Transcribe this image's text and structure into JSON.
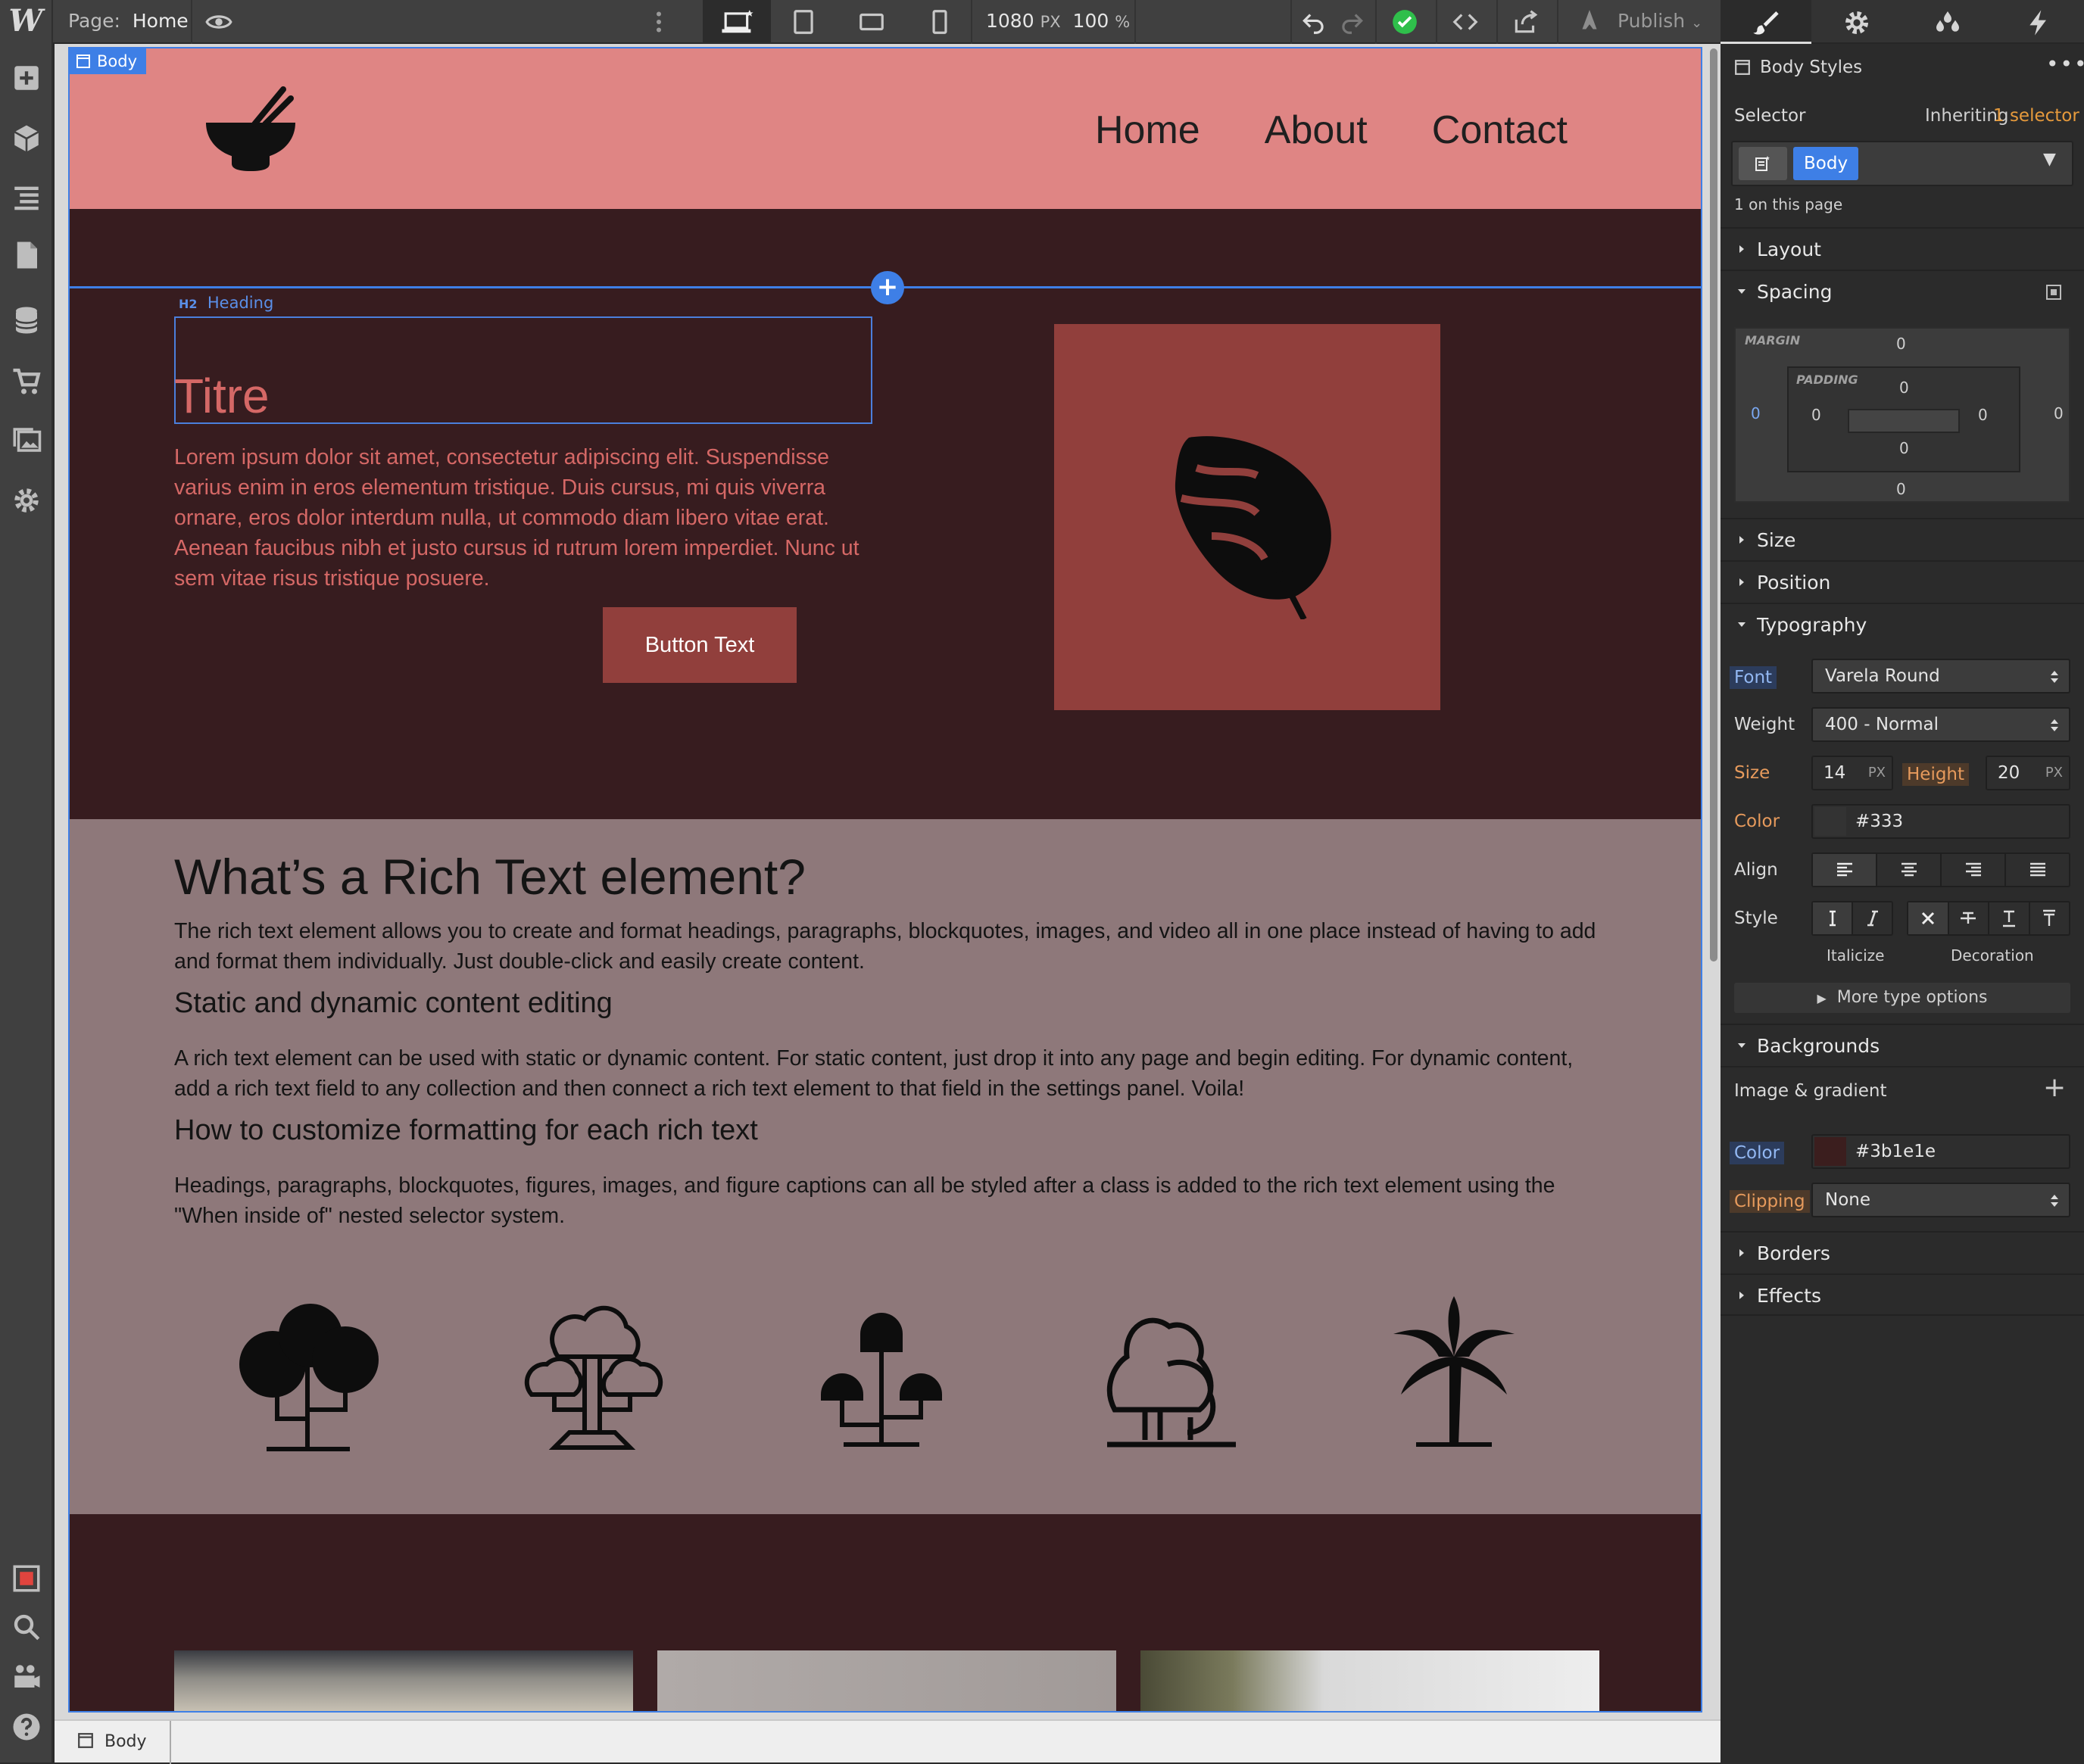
{
  "topbar": {
    "logo": "W",
    "page_label": "Page:",
    "page_name": "Home",
    "width_value": "1080",
    "width_unit": "PX",
    "zoom_value": "100",
    "zoom_unit": "%",
    "publish_label": "Publish"
  },
  "canvas": {
    "body_tag": "Body",
    "nav": {
      "links": [
        "Home",
        "About",
        "Contact"
      ]
    },
    "hero": {
      "heading_label": "Heading",
      "heading_tag": "H2",
      "title": "Titre",
      "paragraph": "Lorem ipsum dolor sit amet, consectetur adipiscing elit. Suspendisse varius enim in eros elementum tristique. Duis cursus, mi quis viverra ornare, eros dolor interdum nulla, ut commodo diam libero vitae erat. Aenean faucibus nibh et justo cursus id rutrum lorem imperdiet. Nunc ut sem vitae risus tristique posuere.",
      "button_text": "Button Text"
    },
    "rich_text": {
      "h1": "What’s a Rich Text element?",
      "p1": "The rich text element allows you to create and format headings, paragraphs, blockquotes, images, and video all in one place instead of having to add and format them individually. Just double-click and easily create content.",
      "h2": "Static and dynamic content editing",
      "p2": "A rich text element can be used with static or dynamic content. For static content, just drop it into any page and begin editing. For dynamic content, add a rich text field to any collection and then connect a rich text element to that field in the settings panel. Voila!",
      "h3": "How to customize formatting for each rich text",
      "p3": "Headings, paragraphs, blockquotes, figures, images, and figure captions can all be styled after a class is added to the rich text element using the \"When inside of\" nested selector system."
    },
    "trees": [
      "round-tree-icon",
      "cloud-tree-icon",
      "mushroom-tree-icon",
      "bush-tree-icon",
      "palm-tree-icon"
    ]
  },
  "breadcrumb": {
    "item": "Body"
  },
  "panel": {
    "title": "Body Styles",
    "selector_label": "Selector",
    "inheriting_text": "Inheriting",
    "inheriting_link": "1 selector",
    "selector_chip": "Body",
    "on_page": "1 on this page",
    "sections": {
      "layout": "Layout",
      "spacing": "Spacing",
      "size": "Size",
      "position": "Position",
      "typography": "Typography",
      "backgrounds": "Backgrounds",
      "borders": "Borders",
      "effects": "Effects"
    },
    "spacing": {
      "margin_label": "MARGIN",
      "padding_label": "PADDING",
      "margin": {
        "top": "0",
        "right": "0",
        "bottom": "0",
        "left": "0"
      },
      "padding": {
        "top": "0",
        "right": "0",
        "bottom": "0",
        "left": "0"
      }
    },
    "typography": {
      "font_label": "Font",
      "font_value": "Varela Round",
      "weight_label": "Weight",
      "weight_value": "400 - Normal",
      "size_label": "Size",
      "size_value": "14",
      "size_unit": "PX",
      "height_label": "Height",
      "height_value": "20",
      "height_unit": "PX",
      "color_label": "Color",
      "color_value": "#333",
      "align_label": "Align",
      "style_label": "Style",
      "italicize": "Italicize",
      "decoration": "Decoration",
      "more": "More type options"
    },
    "backgrounds": {
      "image_gradient": "Image & gradient",
      "color_label": "Color",
      "color_value": "#3b1e1e",
      "clipping_label": "Clipping",
      "clipping_value": "None"
    }
  },
  "colors": {
    "accent": "#3e7fe6",
    "nav_bg": "#df8584",
    "hero_bg": "#371c1f",
    "rich_bg": "#8e787a",
    "button_bg": "#913f3c",
    "title_color": "#d56866",
    "bg_swatch": "#3b1e1e",
    "text_swatch": "#333333",
    "status_ok": "#2fbf4b"
  }
}
